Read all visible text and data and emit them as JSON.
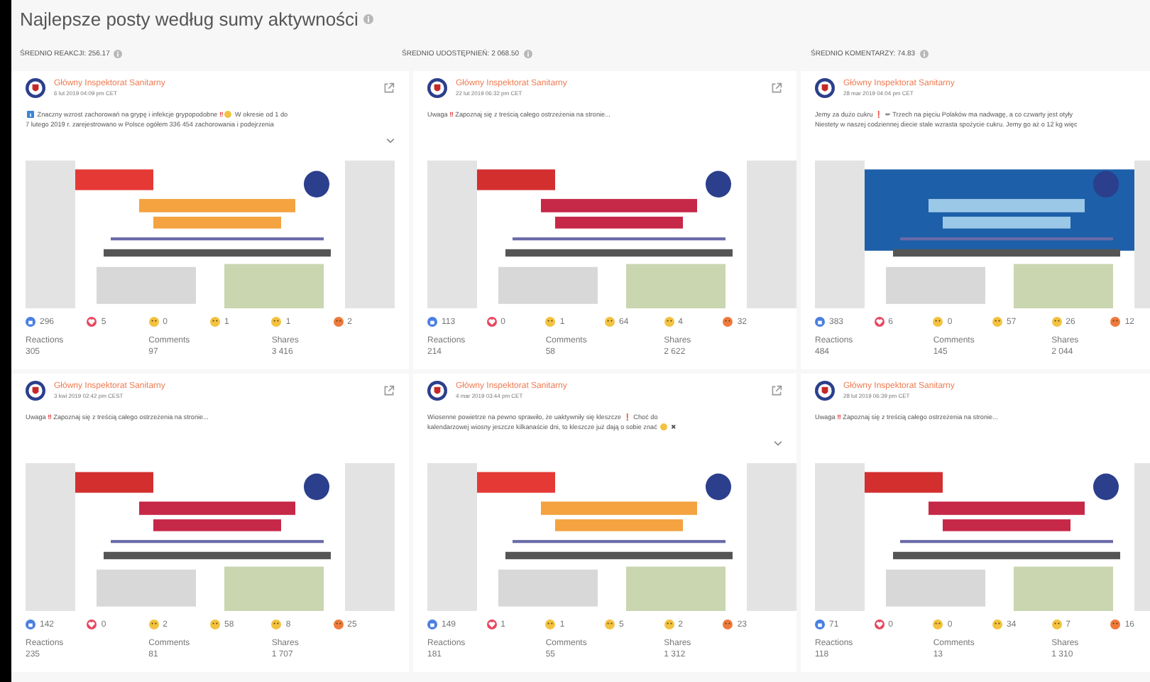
{
  "title": "Najlepsze posty według sumy aktywności",
  "averages": [
    "ŚREDNIO REAKCJI: 256.17",
    "ŚREDNIO UDOSTĘPNIEŃ: 2 068.50",
    "ŚREDNIO KOMENTARZY: 74.83"
  ],
  "posts": [
    {
      "author": "Główny Inspektorat Sanitarny",
      "date": "6 lut 2019 04:09 pm CET",
      "link_icon": true,
      "expandable": true,
      "lines": [
        [
          {
            "kind": "info"
          },
          {
            "kind": "text",
            "text": " Znaczny wzrost zachorowań na grypę i infekcje grypopodobne "
          },
          {
            "kind": "mark",
            "text": "‼"
          },
          {
            "kind": "emoji"
          },
          {
            "kind": "text",
            "text": " W okresie od 1 do"
          }
        ],
        [
          {
            "kind": "text",
            "text": "7 lutego 2019 r. zarejestrowano w Polsce ogółem 336 454 zachorowania i podejrzenia"
          }
        ]
      ],
      "image": {
        "kind": "picture"
      },
      "reactions": [
        {
          "kind": "like",
          "count": "296"
        },
        {
          "kind": "love",
          "count": "5"
        },
        {
          "kind": "haha",
          "count": "0"
        },
        {
          "kind": "wow",
          "count": "1"
        },
        {
          "kind": "sad",
          "count": "1"
        },
        {
          "kind": "angry",
          "count": "2"
        }
      ],
      "stats": [
        {
          "label": "Reactions",
          "value": "305"
        },
        {
          "label": "Comments",
          "value": "97"
        },
        {
          "label": "Shares",
          "value": "3 416"
        }
      ]
    },
    {
      "author": "Główny Inspektorat Sanitarny",
      "date": "22 lut 2019 06:32 pm CET",
      "link_icon": true,
      "expandable": false,
      "lines": [
        [
          {
            "kind": "text",
            "text": "Uwaga "
          },
          {
            "kind": "mark",
            "text": "‼"
          },
          {
            "kind": "text",
            "text": " Zapoznaj się z treścią całego ostrzeżenia na stronie..."
          }
        ]
      ],
      "image": {
        "kind": "picture"
      },
      "reactions": [
        {
          "kind": "like",
          "count": "113"
        },
        {
          "kind": "love",
          "count": "0"
        },
        {
          "kind": "haha",
          "count": "1"
        },
        {
          "kind": "wow",
          "count": "64"
        },
        {
          "kind": "sad",
          "count": "4"
        },
        {
          "kind": "angry",
          "count": "32"
        }
      ],
      "stats": [
        {
          "label": "Reactions",
          "value": "214"
        },
        {
          "label": "Comments",
          "value": "58"
        },
        {
          "label": "Shares",
          "value": "2 622"
        }
      ]
    },
    {
      "author": "Główny Inspektorat Sanitarny",
      "date": "28 mar 2019 04:04 pm CET",
      "link_icon": false,
      "expandable": false,
      "lines": [
        [
          {
            "kind": "text",
            "text": "Jemy za dużo cukru "
          },
          {
            "kind": "mark",
            "text": "❗"
          },
          {
            "kind": "text",
            "text": " ✏ Trzech na pięciu Polaków ma nadwagę, a co czwarty jest otyły"
          }
        ],
        [
          {
            "kind": "text",
            "text": "Niestety w naszej codziennej diecie stale wzrasta spożycie cukru. Jemy go aż o 12 kg więc"
          }
        ]
      ],
      "image": {
        "kind": "picture"
      },
      "reactions": [
        {
          "kind": "like",
          "count": "383"
        },
        {
          "kind": "love",
          "count": "6"
        },
        {
          "kind": "haha",
          "count": "0"
        },
        {
          "kind": "wow",
          "count": "57"
        },
        {
          "kind": "sad",
          "count": "26"
        },
        {
          "kind": "angry",
          "count": "12"
        }
      ],
      "stats": [
        {
          "label": "Reactions",
          "value": "484"
        },
        {
          "label": "Comments",
          "value": "145"
        },
        {
          "label": "Shares",
          "value": "2 044"
        }
      ]
    },
    {
      "author": "Główny Inspektorat Sanitarny",
      "date": "3 kwi 2019 02:42 pm CEST",
      "link_icon": true,
      "expandable": false,
      "lines": [
        [
          {
            "kind": "text",
            "text": "Uwaga "
          },
          {
            "kind": "mark",
            "text": "‼"
          },
          {
            "kind": "text",
            "text": " Zapoznaj się z treścią całego ostrzeżenia na stronie..."
          }
        ]
      ],
      "image": {
        "kind": "picture"
      },
      "reactions": [
        {
          "kind": "like",
          "count": "142"
        },
        {
          "kind": "love",
          "count": "0"
        },
        {
          "kind": "haha",
          "count": "2"
        },
        {
          "kind": "wow",
          "count": "58"
        },
        {
          "kind": "sad",
          "count": "8"
        },
        {
          "kind": "angry",
          "count": "25"
        }
      ],
      "stats": [
        {
          "label": "Reactions",
          "value": "235"
        },
        {
          "label": "Comments",
          "value": "81"
        },
        {
          "label": "Shares",
          "value": "1 707"
        }
      ]
    },
    {
      "author": "Główny Inspektorat Sanitarny",
      "date": "4 mar 2019 03:44 pm CET",
      "link_icon": true,
      "expandable": true,
      "lines": [
        [
          {
            "kind": "text",
            "text": "Wiosenne powietrze na pewno sprawiło, że uaktywniły się kleszcze "
          },
          {
            "kind": "mark",
            "text": "❗"
          },
          {
            "kind": "text",
            "text": " Choć do"
          }
        ],
        [
          {
            "kind": "text",
            "text": "kalendarzowej wiosny jeszcze kilkanaście dni, to kleszcze już dają o sobie znać "
          },
          {
            "kind": "emoji"
          },
          {
            "kind": "text",
            "text": " ✖"
          }
        ]
      ],
      "image": {
        "kind": "picture"
      },
      "reactions": [
        {
          "kind": "like",
          "count": "149"
        },
        {
          "kind": "love",
          "count": "1"
        },
        {
          "kind": "haha",
          "count": "1"
        },
        {
          "kind": "wow",
          "count": "5"
        },
        {
          "kind": "sad",
          "count": "2"
        },
        {
          "kind": "angry",
          "count": "23"
        }
      ],
      "stats": [
        {
          "label": "Reactions",
          "value": "181"
        },
        {
          "label": "Comments",
          "value": "55"
        },
        {
          "label": "Shares",
          "value": "1 312"
        }
      ]
    },
    {
      "author": "Główny Inspektorat Sanitarny",
      "date": "28 lut 2019 06:39 pm CET",
      "link_icon": false,
      "expandable": false,
      "lines": [
        [
          {
            "kind": "text",
            "text": "Uwaga "
          },
          {
            "kind": "mark",
            "text": "‼"
          },
          {
            "kind": "text",
            "text": " Zapoznaj się z treścią całego ostrzeżenia na stronie..."
          }
        ]
      ],
      "image": {
        "kind": "picture"
      },
      "reactions": [
        {
          "kind": "like",
          "count": "71"
        },
        {
          "kind": "love",
          "count": "0"
        },
        {
          "kind": "haha",
          "count": "0"
        },
        {
          "kind": "wow",
          "count": "34"
        },
        {
          "kind": "sad",
          "count": "7"
        },
        {
          "kind": "angry",
          "count": "16"
        }
      ],
      "stats": [
        {
          "label": "Reactions",
          "value": "118"
        },
        {
          "label": "Comments",
          "value": "13"
        },
        {
          "label": "Shares",
          "value": "1 310"
        }
      ]
    }
  ]
}
